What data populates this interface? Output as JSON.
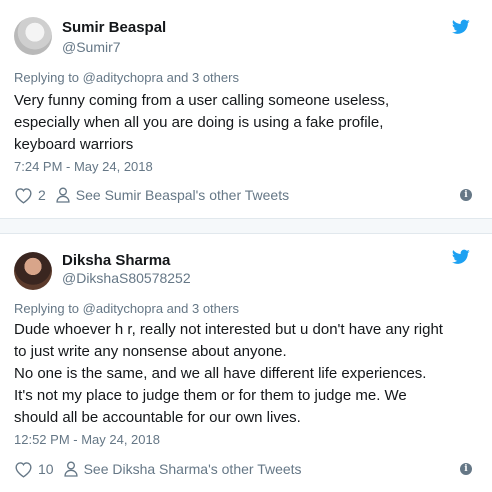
{
  "tweets": [
    {
      "display_name": "Sumir Beaspal",
      "handle": "@Sumir7",
      "reply_prefix": "Replying to ",
      "reply_mention": "@aditychopra",
      "reply_suffix": " and 3 others",
      "text_lines": [
        "Very funny coming from a user calling someone useless,",
        "especially when all you are doing is using a fake profile,",
        "keyboard warriors"
      ],
      "timestamp": "7:24 PM - May 24, 2018",
      "like_count": "2",
      "other_tweets_label": "See Sumir Beaspal's other Tweets"
    },
    {
      "display_name": "Diksha Sharma",
      "handle": "@DikshaS80578252",
      "reply_prefix": "Replying to ",
      "reply_mention": "@aditychopra",
      "reply_suffix": " and 3 others",
      "text_lines": [
        "Dude whoever h r, really not interested but u don't have any right",
        "to just write any nonsense about anyone.",
        "No one is the same, and we all have different life experiences.",
        "It's not my place to judge them or for them to judge me. We",
        "should all be accountable for our own lives."
      ],
      "timestamp": "12:52 PM - May 24, 2018",
      "like_count": "10",
      "other_tweets_label": "See Diksha Sharma's other Tweets"
    }
  ],
  "icons": {
    "brand": "twitter-bird-icon",
    "like": "heart-icon",
    "profile": "person-icon",
    "info": "info-icon"
  },
  "colors": {
    "brand": "#1da1f2",
    "secondary_text": "#657786",
    "primary_text": "#14171a",
    "separator": "#e1e8ed"
  }
}
